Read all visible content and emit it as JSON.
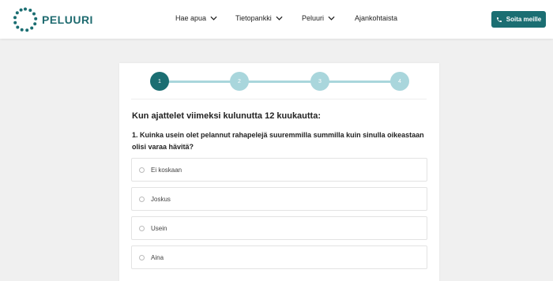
{
  "brand": {
    "name": "PELUURI",
    "color": "#1b6e72"
  },
  "nav": {
    "items": [
      {
        "label": "Hae apua",
        "has_dropdown": true
      },
      {
        "label": "Tietopankki",
        "has_dropdown": true
      },
      {
        "label": "Peluuri",
        "has_dropdown": true
      },
      {
        "label": "Ajankohtaista",
        "has_dropdown": false
      }
    ],
    "call_button": {
      "label": "Soita meille",
      "icon": "phone-icon"
    }
  },
  "stepper": {
    "steps": [
      "1",
      "2",
      "3",
      "4"
    ],
    "current": 1,
    "active_color": "#1b6e72",
    "inactive_color": "#a9d6dc"
  },
  "quiz": {
    "heading": "Kun ajattelet viimeksi kulunutta 12 kuukautta:",
    "question": "1. Kuinka usein olet pelannut rahapelejä suuremmilla summilla kuin sinulla oikeastaan olisi varaa hävitä?",
    "options": [
      "Ei koskaan",
      "Joskus",
      "Usein",
      "Aina"
    ]
  }
}
